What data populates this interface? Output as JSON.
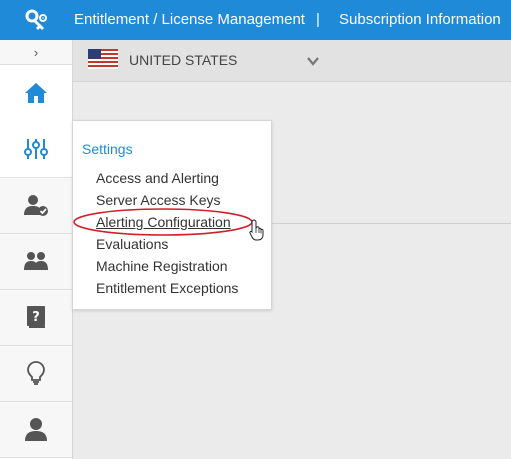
{
  "header": {
    "app_title": "Entitlement / License Management",
    "separator": "|",
    "subscription": "Subscription Information",
    "logo_icon": "key-gear-icon"
  },
  "sidebar": {
    "collapse_glyph": "›",
    "items": [
      {
        "icon": "home-icon",
        "active": true
      },
      {
        "icon": "settings-sliders-icon",
        "hover": true
      },
      {
        "icon": "user-check-icon"
      },
      {
        "icon": "users-icon"
      },
      {
        "icon": "help-book-icon"
      },
      {
        "icon": "lightbulb-icon"
      },
      {
        "icon": "user-icon"
      }
    ]
  },
  "country": {
    "label": "UNITED STATES",
    "flag_icon": "us-flag-icon",
    "caret_icon": "chevron-down-icon"
  },
  "settings_menu": {
    "title": "Settings",
    "items": [
      "Access and Alerting",
      "Server Access Keys",
      "Alerting Configuration",
      "Evaluations",
      "Machine Registration",
      "Entitlement Exceptions"
    ],
    "highlighted_index": 2
  },
  "colors": {
    "brand_blue": "#1f8ad8",
    "annotation_red": "#d0202a"
  }
}
